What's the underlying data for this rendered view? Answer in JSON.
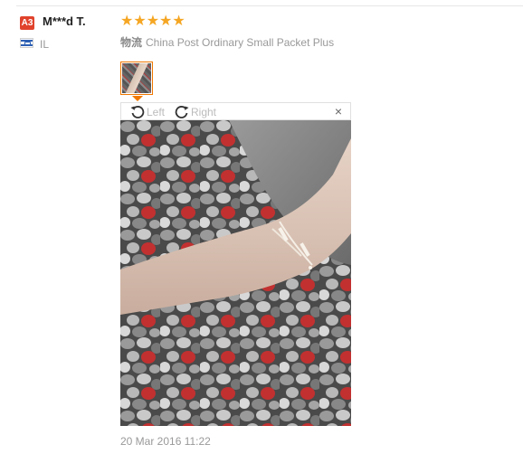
{
  "reviewer": {
    "level_badge": "A3",
    "name": "M***d T.",
    "country": "IL"
  },
  "review": {
    "stars": "★★★★★",
    "rating": 5,
    "shipping_label": "物流",
    "shipping_method": "China Post Ordinary Small Packet Plus",
    "date": "20 Mar 2016 11:22"
  },
  "viewer": {
    "rotate_left_label": "Left",
    "rotate_right_label": "Right",
    "close_symbol": "×"
  },
  "colors": {
    "badge": "#e0422c",
    "stars": "#f5a623",
    "thumb_border": "#f07800"
  }
}
